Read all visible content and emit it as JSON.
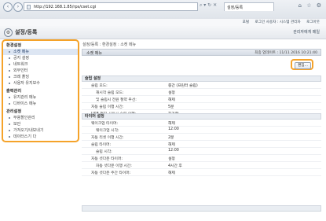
{
  "browser": {
    "back_icon": "back-arrow-icon",
    "forward_icon": "forward-arrow-icon",
    "url": "http://192.168.1.85/rps/cset.cgi",
    "tab_title": "설정/등록",
    "address_tools": "⌕ ▾ ↻ ✕",
    "window_icons": "⌂ ☆ ⚙"
  },
  "utilbar": {
    "links": [
      "포털",
      "로그인 사용자 : 시스템 관리자",
      "로그아웃"
    ]
  },
  "header": {
    "title": "설정/등록",
    "portal_link": "관리자에게 메일"
  },
  "sidebar": {
    "sections": [
      {
        "title": "환경설정",
        "items": [
          "소켓 메뉴",
          "공지 설정",
          "네트워크",
          "외부인터",
          "크레 폴딩",
          "사용자 유지보수"
        ]
      },
      {
        "title": "출력관리",
        "items": [
          "유지관리 메뉴",
          "디바이스 메뉴"
        ]
      },
      {
        "title": "관리설정",
        "items": [
          "부용할인관리",
          "보안",
          "가져오기/내보내기",
          "데이터스기 다"
        ]
      }
    ],
    "active_item": "소켓 메뉴"
  },
  "main": {
    "breadcrumb": "설정/등록 : 환경설정 : 소켓 메뉴",
    "panel_title": "소켓 메뉴",
    "last_updated": "최종 업데이트 : 11/11 2016 10:21:40",
    "edit_label": "편집...",
    "sections": [
      {
        "title": "슬립 설정",
        "rows": [
          {
            "label": "슬립 모드:",
            "value": "중간 (프린터 슬립)",
            "indent": 1
          },
          {
            "label": "재시작 슬립 모드:",
            "value": "설정",
            "indent": 2
          },
          {
            "label": "및 슬립시 전원 절약 우선:",
            "value": "해제",
            "indent": 2
          },
          {
            "label": "자동 슬립 이행 시간:",
            "value": "5분",
            "indent": 1
          },
          {
            "label": "USB 접지 사용시 슬립 이행:",
            "value": "허가함",
            "indent": 1
          }
        ]
      },
      {
        "title": "타이머 설정",
        "rows": [
          {
            "label": "웨이크업 타이머:",
            "value": "해제",
            "indent": 1
          },
          {
            "label": "웨이크업 시각:",
            "value": "12:00",
            "indent": 2
          },
          {
            "label": "자동 리셋 이행 시간:",
            "value": "2분",
            "indent": 1
          },
          {
            "label": "슬립 타이머:",
            "value": "해제",
            "indent": 1
          },
          {
            "label": "슬립 시각:",
            "value": "12:00",
            "indent": 2
          },
          {
            "label": "자동 셧다운 타이머:",
            "value": "설정",
            "indent": 1
          },
          {
            "label": "자동 셧다운 이행 시간:",
            "value": "4시간 후",
            "indent": 2
          },
          {
            "label": "자동 셧다운 주간 타이머:",
            "value": "해제",
            "indent": 1
          }
        ]
      }
    ]
  }
}
